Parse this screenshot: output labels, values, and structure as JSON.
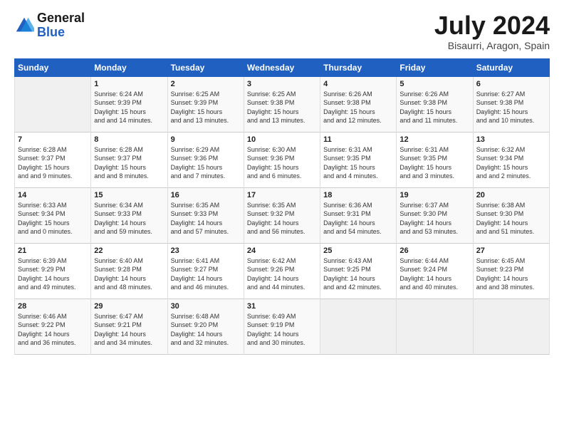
{
  "header": {
    "logo_general": "General",
    "logo_blue": "Blue",
    "month_title": "July 2024",
    "subtitle": "Bisaurri, Aragon, Spain"
  },
  "weekdays": [
    "Sunday",
    "Monday",
    "Tuesday",
    "Wednesday",
    "Thursday",
    "Friday",
    "Saturday"
  ],
  "weeks": [
    [
      {
        "day": "",
        "sunrise": "",
        "sunset": "",
        "daylight": ""
      },
      {
        "day": "1",
        "sunrise": "Sunrise: 6:24 AM",
        "sunset": "Sunset: 9:39 PM",
        "daylight": "Daylight: 15 hours and 14 minutes."
      },
      {
        "day": "2",
        "sunrise": "Sunrise: 6:25 AM",
        "sunset": "Sunset: 9:39 PM",
        "daylight": "Daylight: 15 hours and 13 minutes."
      },
      {
        "day": "3",
        "sunrise": "Sunrise: 6:25 AM",
        "sunset": "Sunset: 9:38 PM",
        "daylight": "Daylight: 15 hours and 13 minutes."
      },
      {
        "day": "4",
        "sunrise": "Sunrise: 6:26 AM",
        "sunset": "Sunset: 9:38 PM",
        "daylight": "Daylight: 15 hours and 12 minutes."
      },
      {
        "day": "5",
        "sunrise": "Sunrise: 6:26 AM",
        "sunset": "Sunset: 9:38 PM",
        "daylight": "Daylight: 15 hours and 11 minutes."
      },
      {
        "day": "6",
        "sunrise": "Sunrise: 6:27 AM",
        "sunset": "Sunset: 9:38 PM",
        "daylight": "Daylight: 15 hours and 10 minutes."
      }
    ],
    [
      {
        "day": "7",
        "sunrise": "Sunrise: 6:28 AM",
        "sunset": "Sunset: 9:37 PM",
        "daylight": "Daylight: 15 hours and 9 minutes."
      },
      {
        "day": "8",
        "sunrise": "Sunrise: 6:28 AM",
        "sunset": "Sunset: 9:37 PM",
        "daylight": "Daylight: 15 hours and 8 minutes."
      },
      {
        "day": "9",
        "sunrise": "Sunrise: 6:29 AM",
        "sunset": "Sunset: 9:36 PM",
        "daylight": "Daylight: 15 hours and 7 minutes."
      },
      {
        "day": "10",
        "sunrise": "Sunrise: 6:30 AM",
        "sunset": "Sunset: 9:36 PM",
        "daylight": "Daylight: 15 hours and 6 minutes."
      },
      {
        "day": "11",
        "sunrise": "Sunrise: 6:31 AM",
        "sunset": "Sunset: 9:35 PM",
        "daylight": "Daylight: 15 hours and 4 minutes."
      },
      {
        "day": "12",
        "sunrise": "Sunrise: 6:31 AM",
        "sunset": "Sunset: 9:35 PM",
        "daylight": "Daylight: 15 hours and 3 minutes."
      },
      {
        "day": "13",
        "sunrise": "Sunrise: 6:32 AM",
        "sunset": "Sunset: 9:34 PM",
        "daylight": "Daylight: 15 hours and 2 minutes."
      }
    ],
    [
      {
        "day": "14",
        "sunrise": "Sunrise: 6:33 AM",
        "sunset": "Sunset: 9:34 PM",
        "daylight": "Daylight: 15 hours and 0 minutes."
      },
      {
        "day": "15",
        "sunrise": "Sunrise: 6:34 AM",
        "sunset": "Sunset: 9:33 PM",
        "daylight": "Daylight: 14 hours and 59 minutes."
      },
      {
        "day": "16",
        "sunrise": "Sunrise: 6:35 AM",
        "sunset": "Sunset: 9:33 PM",
        "daylight": "Daylight: 14 hours and 57 minutes."
      },
      {
        "day": "17",
        "sunrise": "Sunrise: 6:35 AM",
        "sunset": "Sunset: 9:32 PM",
        "daylight": "Daylight: 14 hours and 56 minutes."
      },
      {
        "day": "18",
        "sunrise": "Sunrise: 6:36 AM",
        "sunset": "Sunset: 9:31 PM",
        "daylight": "Daylight: 14 hours and 54 minutes."
      },
      {
        "day": "19",
        "sunrise": "Sunrise: 6:37 AM",
        "sunset": "Sunset: 9:30 PM",
        "daylight": "Daylight: 14 hours and 53 minutes."
      },
      {
        "day": "20",
        "sunrise": "Sunrise: 6:38 AM",
        "sunset": "Sunset: 9:30 PM",
        "daylight": "Daylight: 14 hours and 51 minutes."
      }
    ],
    [
      {
        "day": "21",
        "sunrise": "Sunrise: 6:39 AM",
        "sunset": "Sunset: 9:29 PM",
        "daylight": "Daylight: 14 hours and 49 minutes."
      },
      {
        "day": "22",
        "sunrise": "Sunrise: 6:40 AM",
        "sunset": "Sunset: 9:28 PM",
        "daylight": "Daylight: 14 hours and 48 minutes."
      },
      {
        "day": "23",
        "sunrise": "Sunrise: 6:41 AM",
        "sunset": "Sunset: 9:27 PM",
        "daylight": "Daylight: 14 hours and 46 minutes."
      },
      {
        "day": "24",
        "sunrise": "Sunrise: 6:42 AM",
        "sunset": "Sunset: 9:26 PM",
        "daylight": "Daylight: 14 hours and 44 minutes."
      },
      {
        "day": "25",
        "sunrise": "Sunrise: 6:43 AM",
        "sunset": "Sunset: 9:25 PM",
        "daylight": "Daylight: 14 hours and 42 minutes."
      },
      {
        "day": "26",
        "sunrise": "Sunrise: 6:44 AM",
        "sunset": "Sunset: 9:24 PM",
        "daylight": "Daylight: 14 hours and 40 minutes."
      },
      {
        "day": "27",
        "sunrise": "Sunrise: 6:45 AM",
        "sunset": "Sunset: 9:23 PM",
        "daylight": "Daylight: 14 hours and 38 minutes."
      }
    ],
    [
      {
        "day": "28",
        "sunrise": "Sunrise: 6:46 AM",
        "sunset": "Sunset: 9:22 PM",
        "daylight": "Daylight: 14 hours and 36 minutes."
      },
      {
        "day": "29",
        "sunrise": "Sunrise: 6:47 AM",
        "sunset": "Sunset: 9:21 PM",
        "daylight": "Daylight: 14 hours and 34 minutes."
      },
      {
        "day": "30",
        "sunrise": "Sunrise: 6:48 AM",
        "sunset": "Sunset: 9:20 PM",
        "daylight": "Daylight: 14 hours and 32 minutes."
      },
      {
        "day": "31",
        "sunrise": "Sunrise: 6:49 AM",
        "sunset": "Sunset: 9:19 PM",
        "daylight": "Daylight: 14 hours and 30 minutes."
      },
      {
        "day": "",
        "sunrise": "",
        "sunset": "",
        "daylight": ""
      },
      {
        "day": "",
        "sunrise": "",
        "sunset": "",
        "daylight": ""
      },
      {
        "day": "",
        "sunrise": "",
        "sunset": "",
        "daylight": ""
      }
    ]
  ]
}
